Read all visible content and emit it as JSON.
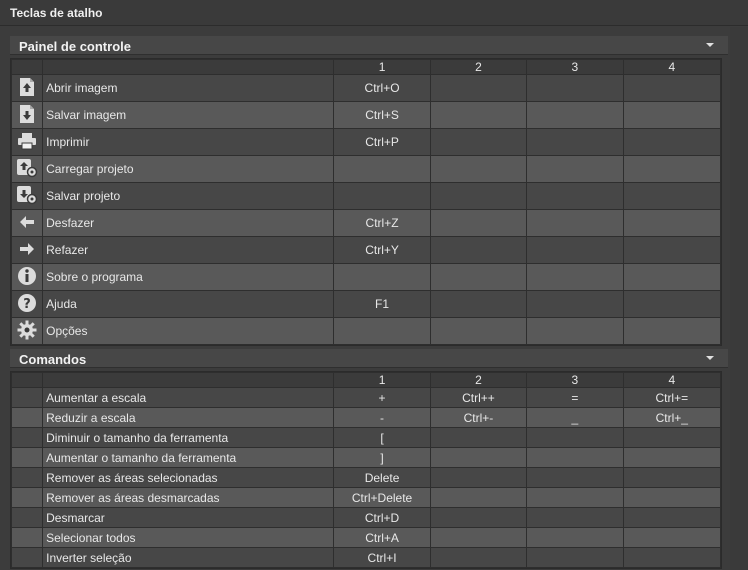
{
  "window": {
    "title": "Teclas de atalho"
  },
  "panel": {
    "title": "Painel de controle",
    "columns": [
      "1",
      "2",
      "3",
      "4"
    ],
    "rows": [
      {
        "icon": "open-image-icon",
        "label": "Abrir imagem",
        "keys": [
          "Ctrl+O",
          "",
          "",
          ""
        ]
      },
      {
        "icon": "save-image-icon",
        "label": "Salvar imagem",
        "keys": [
          "Ctrl+S",
          "",
          "",
          ""
        ]
      },
      {
        "icon": "printer-icon",
        "label": "Imprimir",
        "keys": [
          "Ctrl+P",
          "",
          "",
          ""
        ]
      },
      {
        "icon": "load-project-icon",
        "label": "Carregar projeto",
        "keys": [
          "",
          "",
          "",
          ""
        ]
      },
      {
        "icon": "save-project-icon",
        "label": "Salvar projeto",
        "keys": [
          "",
          "",
          "",
          ""
        ]
      },
      {
        "icon": "undo-arrow-icon",
        "label": "Desfazer",
        "keys": [
          "Ctrl+Z",
          "",
          "",
          ""
        ]
      },
      {
        "icon": "redo-arrow-icon",
        "label": "Refazer",
        "keys": [
          "Ctrl+Y",
          "",
          "",
          ""
        ]
      },
      {
        "icon": "info-icon",
        "label": "Sobre o programa",
        "keys": [
          "",
          "",
          "",
          ""
        ]
      },
      {
        "icon": "help-icon",
        "label": "Ajuda",
        "keys": [
          "F1",
          "",
          "",
          ""
        ]
      },
      {
        "icon": "gear-icon",
        "label": "Opções",
        "keys": [
          "",
          "",
          "",
          ""
        ]
      }
    ]
  },
  "commands": {
    "title": "Comandos",
    "columns": [
      "1",
      "2",
      "3",
      "4"
    ],
    "rows": [
      {
        "label": "Aumentar a escala",
        "keys": [
          "+",
          "Ctrl++",
          "=",
          "Ctrl+="
        ]
      },
      {
        "label": "Reduzir a escala",
        "keys": [
          "-",
          "Ctrl+-",
          "_",
          "Ctrl+_"
        ]
      },
      {
        "label": "Diminuir o tamanho da ferramenta",
        "keys": [
          "[",
          "",
          "",
          ""
        ]
      },
      {
        "label": "Aumentar o tamanho da ferramenta",
        "keys": [
          "]",
          "",
          "",
          ""
        ]
      },
      {
        "label": "Remover as áreas selecionadas",
        "keys": [
          "Delete",
          "",
          "",
          ""
        ]
      },
      {
        "label": "Remover as áreas desmarcadas",
        "keys": [
          "Ctrl+Delete",
          "",
          "",
          ""
        ]
      },
      {
        "label": "Desmarcar",
        "keys": [
          "Ctrl+D",
          "",
          "",
          ""
        ]
      },
      {
        "label": "Selecionar todos",
        "keys": [
          "Ctrl+A",
          "",
          "",
          ""
        ]
      },
      {
        "label": "Inverter seleção",
        "keys": [
          "Ctrl+I",
          "",
          "",
          ""
        ]
      }
    ]
  }
}
